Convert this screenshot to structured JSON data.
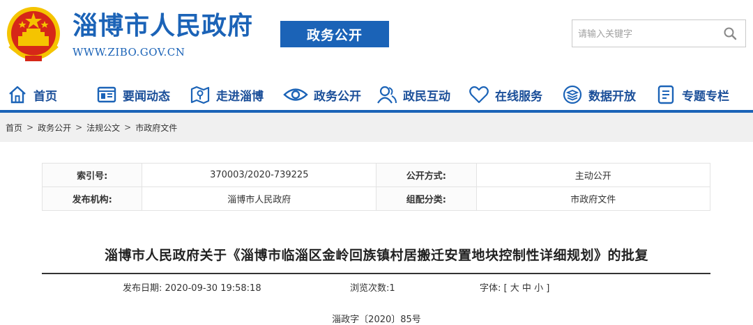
{
  "header": {
    "site_title": "淄博市人民政府",
    "site_url": "WWW.ZIBO.GOV.CN",
    "section_badge": "政务公开",
    "search_placeholder": "请输入关键字",
    "emblem_icon": "national-emblem-icon"
  },
  "nav": {
    "items": [
      {
        "label": "首页",
        "icon": "home-icon"
      },
      {
        "label": "要闻动态",
        "icon": "news-icon"
      },
      {
        "label": "走进淄博",
        "icon": "map-icon"
      },
      {
        "label": "政务公开",
        "icon": "eye-icon"
      },
      {
        "label": "政民互动",
        "icon": "people-icon"
      },
      {
        "label": "在线服务",
        "icon": "heart-icon"
      },
      {
        "label": "数据开放",
        "icon": "layers-icon"
      },
      {
        "label": "专题专栏",
        "icon": "document-icon"
      }
    ]
  },
  "breadcrumb": [
    "首页",
    "政务公开",
    "法规公文",
    "市政府文件"
  ],
  "breadcrumb_separator": ">",
  "meta": {
    "index_label": "索引号:",
    "index_value": "370003/2020-739225",
    "publish_method_label": "公开方式:",
    "publish_method_value": "主动公开",
    "issuer_label": "发布机构:",
    "issuer_value": "淄博市人民政府",
    "category_label": "组配分类:",
    "category_value": "市政府文件"
  },
  "article": {
    "title": "淄博市人民政府关于《淄博市临淄区金岭回族镇村居搬迁安置地块控制性详细规划》的批复",
    "date_label": "发布日期:",
    "date_value": "2020-09-30 19:58:18",
    "views_label": "浏览次数:",
    "views_value": "1",
    "font_label": "字体:",
    "font_open": "[",
    "font_large": "大",
    "font_medium": "中",
    "font_small": "小",
    "font_close": "]",
    "doc_number": "淄政字〔2020〕85号"
  },
  "colors": {
    "brand_blue": "#1b63b7",
    "nav_text": "#1b4f99",
    "emblem_red": "#d62718",
    "emblem_gold": "#f5c400"
  }
}
